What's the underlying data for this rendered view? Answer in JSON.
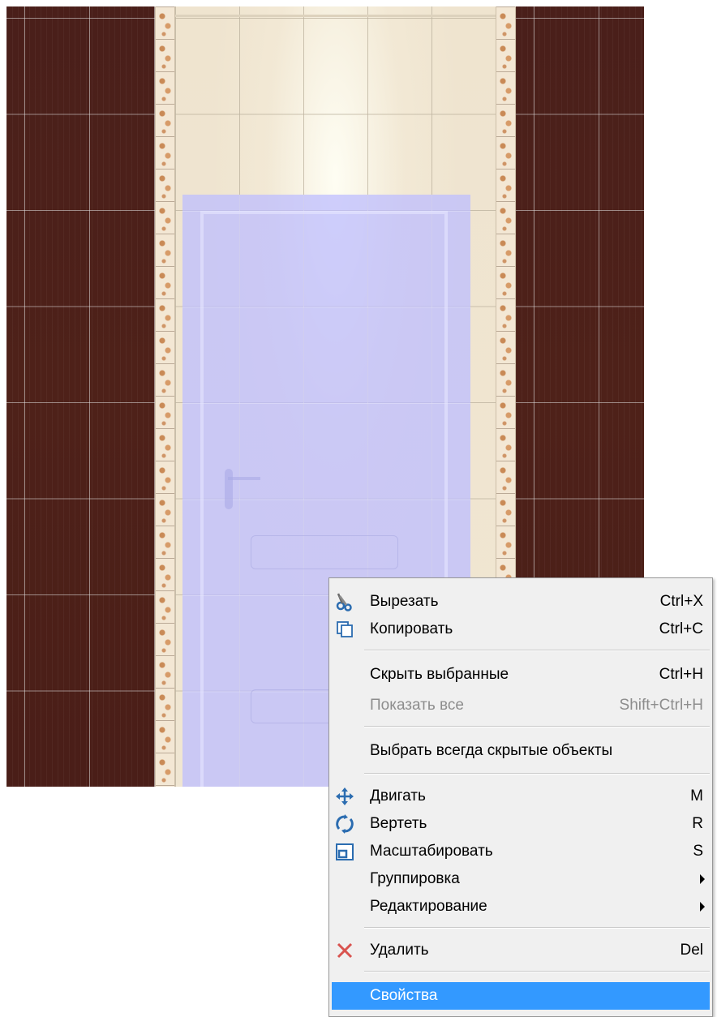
{
  "scene": {
    "colors": {
      "dark_tile": "#4e2119",
      "light_tile": "#f0e6d2",
      "border_strip": "#f3e7d4",
      "door_selection": "#bebeff"
    }
  },
  "context_menu": {
    "items": [
      {
        "label": "Вырезать",
        "shortcut": "Ctrl+X",
        "icon": "scissors-icon"
      },
      {
        "label": "Копировать",
        "shortcut": "Ctrl+C",
        "icon": "copy-icon"
      },
      {
        "label": "Скрыть выбранные",
        "shortcut": "Ctrl+H"
      },
      {
        "label": "Показать все",
        "shortcut": "Shift+Ctrl+H",
        "disabled": true
      },
      {
        "label": "Выбрать всегда скрытые объекты"
      },
      {
        "label": "Двигать",
        "shortcut": "M",
        "icon": "move-arrows-icon"
      },
      {
        "label": "Вертеть",
        "shortcut": "R",
        "icon": "rotate-icon"
      },
      {
        "label": "Масштабировать",
        "shortcut": "S",
        "icon": "scale-icon"
      },
      {
        "label": "Группировка",
        "submenu": true
      },
      {
        "label": "Редактирование",
        "submenu": true
      },
      {
        "label": "Удалить",
        "shortcut": "Del",
        "icon": "delete-x-icon"
      },
      {
        "label": "Свойства",
        "selected": true
      }
    ],
    "colors": {
      "background": "#f0f0f0",
      "highlight": "#3399ff",
      "disabled_text": "#8d8d8d",
      "delete_icon": "#d9534f",
      "icon_blue": "#2b6cb0"
    }
  }
}
